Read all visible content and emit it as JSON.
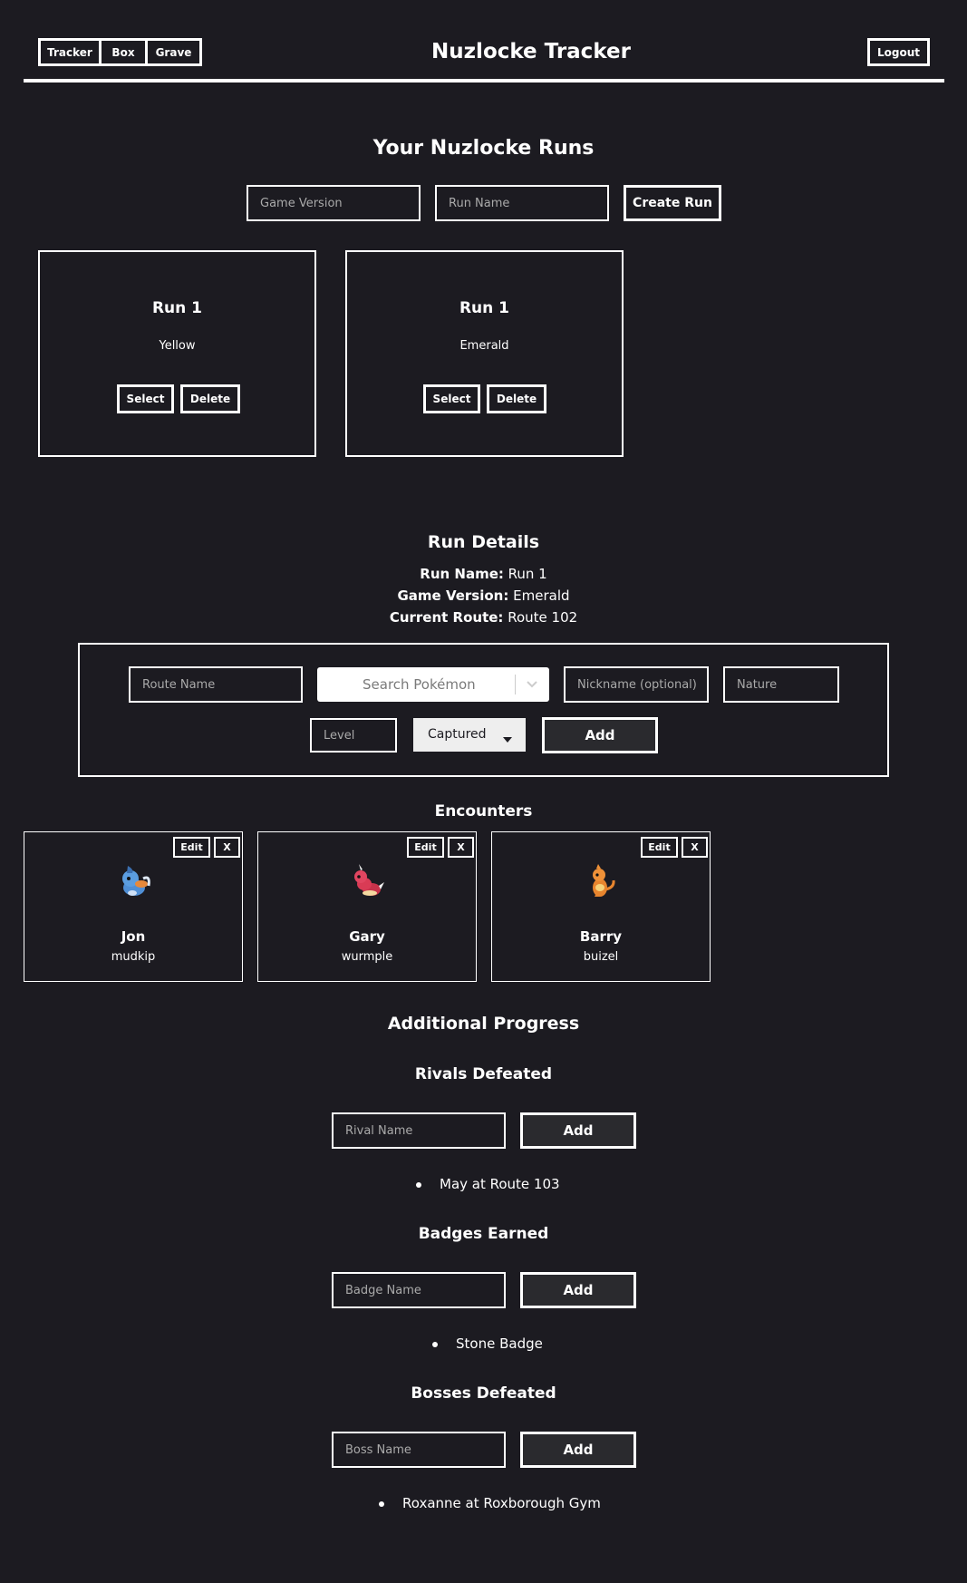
{
  "nav": {
    "tabs": [
      "Tracker",
      "Box",
      "Grave"
    ],
    "title": "Nuzlocke Tracker",
    "logout": "Logout"
  },
  "runs_section": {
    "heading": "Your Nuzlocke Runs",
    "game_version_placeholder": "Game Version",
    "run_name_placeholder": "Run Name",
    "create_button": "Create Run",
    "runs": [
      {
        "name": "Run 1",
        "version": "Yellow",
        "select": "Select",
        "delete": "Delete"
      },
      {
        "name": "Run 1",
        "version": "Emerald",
        "select": "Select",
        "delete": "Delete"
      }
    ]
  },
  "run_details": {
    "heading": "Run Details",
    "run_name_label": "Run Name:",
    "run_name_value": "Run 1",
    "game_version_label": "Game Version:",
    "game_version_value": "Emerald",
    "current_route_label": "Current Route:",
    "current_route_value": "Route 102"
  },
  "encounter_form": {
    "route_placeholder": "Route Name",
    "search_placeholder": "Search Pokémon",
    "nickname_placeholder": "Nickname (optional)",
    "nature_placeholder": "Nature",
    "level_placeholder": "Level",
    "status_selected": "Captured",
    "add_button": "Add"
  },
  "encounters": {
    "heading": "Encounters",
    "edit_label": "Edit",
    "remove_label": "X",
    "items": [
      {
        "nickname": "Jon",
        "species": "mudkip"
      },
      {
        "nickname": "Gary",
        "species": "wurmple"
      },
      {
        "nickname": "Barry",
        "species": "buizel"
      }
    ]
  },
  "additional_progress": {
    "heading": "Additional Progress",
    "rivals": {
      "heading": "Rivals Defeated",
      "placeholder": "Rival Name",
      "add": "Add",
      "items": [
        "May at Route 103"
      ]
    },
    "badges": {
      "heading": "Badges Earned",
      "placeholder": "Badge Name",
      "add": "Add",
      "items": [
        "Stone Badge"
      ]
    },
    "bosses": {
      "heading": "Bosses Defeated",
      "placeholder": "Boss Name",
      "add": "Add",
      "items": [
        "Roxanne at Roxborough Gym"
      ]
    }
  },
  "colors": {
    "background": "#1c1b21",
    "foreground": "#ffffff",
    "button_dark": "#2a2a2e"
  }
}
